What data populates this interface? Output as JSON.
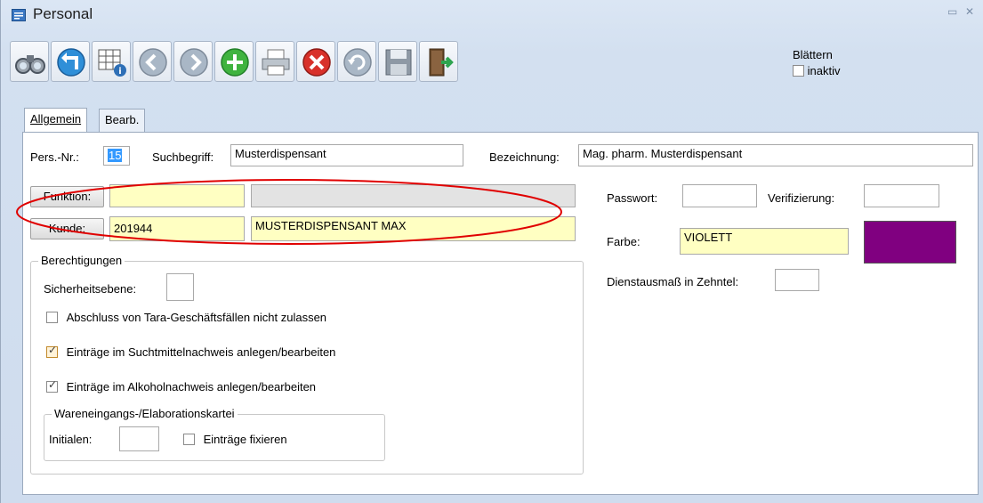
{
  "window": {
    "title": "Personal"
  },
  "toolbar": {
    "buttons": [
      "search",
      "back",
      "grid-info",
      "prev",
      "next",
      "add",
      "print",
      "cancel",
      "undo",
      "save",
      "exit"
    ]
  },
  "blaettern": {
    "label": "Blättern",
    "checkbox_label": "inaktiv",
    "checked": false
  },
  "tabs": [
    {
      "label": "Allgemein",
      "active": true
    },
    {
      "label": "Bearb.",
      "active": false
    }
  ],
  "form": {
    "pers_nr_label": "Pers.-Nr.:",
    "pers_nr_value": "15",
    "suchbegriff_label": "Suchbegriff:",
    "suchbegriff_value": "Musterdispensant",
    "bezeichnung_label": "Bezeichnung:",
    "bezeichnung_value": "Mag. pharm. Musterdispensant",
    "funktion_button": "Funktion:",
    "funktion_code": "",
    "funktion_name": "",
    "kunde_button": "Kunde:",
    "kunde_code": "201944",
    "kunde_name": "MUSTERDISPENSANT MAX",
    "passwort_label": "Passwort:",
    "passwort_value": "",
    "verifizierung_label": "Verifizierung:",
    "verifizierung_value": "",
    "farbe_label": "Farbe:",
    "farbe_value": "VIOLETT",
    "dienstausmass_label": "Dienstausmaß in Zehntel:",
    "dienstausmass_value": ""
  },
  "berechtigungen": {
    "title": "Berechtigungen",
    "sicherheitsebene_label": "Sicherheitsebene:",
    "sicherheitsebene_value": "",
    "options": [
      {
        "label": "Abschluss von Tara-Geschäftsfällen nicht zulassen",
        "checked": false
      },
      {
        "label": "Einträge im Suchtmittelnachweis anlegen/bearbeiten",
        "checked": true
      },
      {
        "label": "Einträge im Alkoholnachweis anlegen/bearbeiten",
        "checked": true
      }
    ],
    "kartei": {
      "title": "Wareneingangs-/Elaborationskartei",
      "initialen_label": "Initialen:",
      "initialen_value": "",
      "fixieren_label": "Einträge fixieren",
      "fixieren_checked": false
    }
  },
  "colors": {
    "farbe_swatch": "#800080",
    "highlight_ellipse": "#e00000",
    "field_yellow": "#ffffc2"
  }
}
